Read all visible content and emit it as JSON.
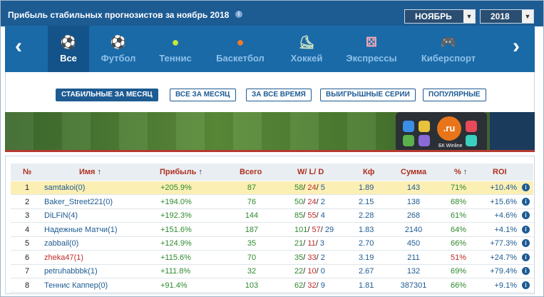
{
  "header": {
    "title": "Прибыль стабильных прогнозистов за ноябрь 2018",
    "month_select": "НОЯБРЬ",
    "year_select": "2018"
  },
  "sports": [
    {
      "label": "Все",
      "icon": "all-sports-icon"
    },
    {
      "label": "Футбол",
      "icon": "soccer-ball-icon"
    },
    {
      "label": "Теннис",
      "icon": "tennis-ball-icon"
    },
    {
      "label": "Баскетбол",
      "icon": "basketball-icon"
    },
    {
      "label": "Хоккей",
      "icon": "hockey-skate-icon"
    },
    {
      "label": "Экспрессы",
      "icon": "dice-icon"
    },
    {
      "label": "Киберспорт",
      "icon": "gamepad-icon"
    }
  ],
  "filters": [
    "СТАБИЛЬНЫЕ ЗА МЕСЯЦ",
    "ВСЕ ЗА МЕСЯЦ",
    "ЗА ВСЕ ВРЕМЯ",
    "ВЫИГРЫШНЫЕ СЕРИИ",
    "ПОПУЛЯРНЫЕ"
  ],
  "banner": {
    "logo_text": ".ru",
    "app_label": "БК Winline"
  },
  "table": {
    "headers": {
      "num": "№",
      "name": "Имя",
      "profit": "Прибыль",
      "total": "Всего",
      "wld": "W/ L/ D",
      "kf": "Кф",
      "sum": "Сумма",
      "pct": "%",
      "roi": "ROI"
    },
    "rows": [
      {
        "n": "1",
        "name": "samtakoi(0)",
        "profit": "+205.9%",
        "total": "87",
        "w": "58",
        "l": "24",
        "d": "5",
        "kf": "1.89",
        "sum": "143",
        "pct": "71%",
        "roi": "+10.4%"
      },
      {
        "n": "2",
        "name": "Baker_Street221(0)",
        "profit": "+194.0%",
        "total": "76",
        "w": "50",
        "l": "24",
        "d": "2",
        "kf": "2.15",
        "sum": "138",
        "pct": "68%",
        "roi": "+15.6%"
      },
      {
        "n": "3",
        "name": "DiLFiN(4)",
        "profit": "+192.3%",
        "total": "144",
        "w": "85",
        "l": "55",
        "d": "4",
        "kf": "2.28",
        "sum": "268",
        "pct": "61%",
        "roi": "+4.6%"
      },
      {
        "n": "4",
        "name": "Надежные Матчи(1)",
        "profit": "+151.6%",
        "total": "187",
        "w": "101",
        "l": "57",
        "d": "29",
        "kf": "1.83",
        "sum": "2140",
        "pct": "64%",
        "roi": "+4.1%"
      },
      {
        "n": "5",
        "name": "zabbail(0)",
        "profit": "+124.9%",
        "total": "35",
        "w": "21",
        "l": "11",
        "d": "3",
        "kf": "2.70",
        "sum": "450",
        "pct": "66%",
        "roi": "+77.3%"
      },
      {
        "n": "6",
        "name": "zheka47(1)",
        "profit": "+115.6%",
        "total": "70",
        "w": "35",
        "l": "33",
        "d": "2",
        "kf": "3.19",
        "sum": "211",
        "pct": "51%",
        "roi": "+24.7%"
      },
      {
        "n": "7",
        "name": "petruhabbbk(1)",
        "profit": "+111.8%",
        "total": "32",
        "w": "22",
        "l": "10",
        "d": "0",
        "kf": "2.67",
        "sum": "132",
        "pct": "69%",
        "roi": "+79.4%"
      },
      {
        "n": "8",
        "name": "Теннис Каппер(0)",
        "profit": "+91.4%",
        "total": "103",
        "w": "62",
        "l": "32",
        "d": "9",
        "kf": "1.81",
        "sum": "387301",
        "pct": "66%",
        "roi": "+9.1%"
      }
    ]
  }
}
